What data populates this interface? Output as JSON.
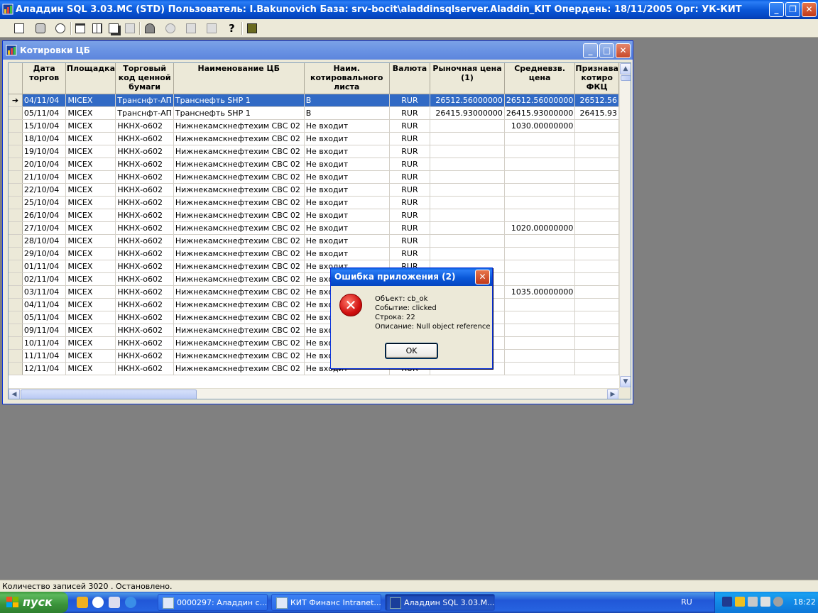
{
  "app": {
    "title": "Аладдин SQL 3.03.MC (STD)  Пользователь: I.Bakunovich База: srv-bocit\\aladdinsqlserver.Aladdin_KIT Опердень: 18/11/2005 Орг: УК-КИТ"
  },
  "window": {
    "title": "Котировки ЦБ"
  },
  "grid": {
    "columns": [
      "Дата торгов",
      "Площадка",
      "Торговый код ценной бумаги",
      "Наименование ЦБ",
      "Наим. котировального листа",
      "Валюта",
      "Рыночная цена (1)",
      "Средневзв. цена",
      "Признава котиро ФКЦ"
    ],
    "rows": [
      {
        "date": "04/11/04",
        "venue": "MICEX",
        "code": "Транснфт-АП",
        "name": "Транснефть SHP  1",
        "list": "В",
        "cur": "RUR",
        "mkt": "26512.56000000",
        "avg": "26512.56000000",
        "rec": "26512.56",
        "selected": true
      },
      {
        "date": "05/11/04",
        "venue": "MICEX",
        "code": "Транснфт-АП",
        "name": "Транснефть SHP  1",
        "list": "В",
        "cur": "RUR",
        "mkt": "26415.93000000",
        "avg": "26415.93000000",
        "rec": "26415.93"
      },
      {
        "date": "15/10/04",
        "venue": "MICEX",
        "code": "НКНХ-о602",
        "name": "Нижнекамскнефтехим СВС  02",
        "list": "Не входит",
        "cur": "RUR",
        "mkt": "",
        "avg": "1030.00000000",
        "rec": ""
      },
      {
        "date": "18/10/04",
        "venue": "MICEX",
        "code": "НКНХ-о602",
        "name": "Нижнекамскнефтехим СВС  02",
        "list": "Не входит",
        "cur": "RUR",
        "mkt": "",
        "avg": "",
        "rec": ""
      },
      {
        "date": "19/10/04",
        "venue": "MICEX",
        "code": "НКНХ-о602",
        "name": "Нижнекамскнефтехим СВС  02",
        "list": "Не входит",
        "cur": "RUR",
        "mkt": "",
        "avg": "",
        "rec": ""
      },
      {
        "date": "20/10/04",
        "venue": "MICEX",
        "code": "НКНХ-о602",
        "name": "Нижнекамскнефтехим СВС  02",
        "list": "Не входит",
        "cur": "RUR",
        "mkt": "",
        "avg": "",
        "rec": ""
      },
      {
        "date": "21/10/04",
        "venue": "MICEX",
        "code": "НКНХ-о602",
        "name": "Нижнекамскнефтехим СВС  02",
        "list": "Не входит",
        "cur": "RUR",
        "mkt": "",
        "avg": "",
        "rec": ""
      },
      {
        "date": "22/10/04",
        "venue": "MICEX",
        "code": "НКНХ-о602",
        "name": "Нижнекамскнефтехим СВС  02",
        "list": "Не входит",
        "cur": "RUR",
        "mkt": "",
        "avg": "",
        "rec": ""
      },
      {
        "date": "25/10/04",
        "venue": "MICEX",
        "code": "НКНХ-о602",
        "name": "Нижнекамскнефтехим СВС  02",
        "list": "Не входит",
        "cur": "RUR",
        "mkt": "",
        "avg": "",
        "rec": ""
      },
      {
        "date": "26/10/04",
        "venue": "MICEX",
        "code": "НКНХ-о602",
        "name": "Нижнекамскнефтехим СВС  02",
        "list": "Не входит",
        "cur": "RUR",
        "mkt": "",
        "avg": "",
        "rec": ""
      },
      {
        "date": "27/10/04",
        "venue": "MICEX",
        "code": "НКНХ-о602",
        "name": "Нижнекамскнефтехим СВС  02",
        "list": "Не входит",
        "cur": "RUR",
        "mkt": "",
        "avg": "1020.00000000",
        "rec": ""
      },
      {
        "date": "28/10/04",
        "venue": "MICEX",
        "code": "НКНХ-о602",
        "name": "Нижнекамскнефтехим СВС  02",
        "list": "Не входит",
        "cur": "RUR",
        "mkt": "",
        "avg": "",
        "rec": ""
      },
      {
        "date": "29/10/04",
        "venue": "MICEX",
        "code": "НКНХ-о602",
        "name": "Нижнекамскнефтехим СВС  02",
        "list": "Не входит",
        "cur": "RUR",
        "mkt": "",
        "avg": "",
        "rec": ""
      },
      {
        "date": "01/11/04",
        "venue": "MICEX",
        "code": "НКНХ-о602",
        "name": "Нижнекамскнефтехим СВС  02",
        "list": "Не входит",
        "cur": "RUR",
        "mkt": "",
        "avg": "",
        "rec": ""
      },
      {
        "date": "02/11/04",
        "venue": "MICEX",
        "code": "НКНХ-о602",
        "name": "Нижнекамскнефтехим СВС  02",
        "list": "Не входит",
        "cur": "RUR",
        "mkt": "",
        "avg": "",
        "rec": ""
      },
      {
        "date": "03/11/04",
        "venue": "MICEX",
        "code": "НКНХ-о602",
        "name": "Нижнекамскнефтехим СВС  02",
        "list": "Не входит",
        "cur": "RUR",
        "mkt": "",
        "avg": "1035.00000000",
        "rec": ""
      },
      {
        "date": "04/11/04",
        "venue": "MICEX",
        "code": "НКНХ-о602",
        "name": "Нижнекамскнефтехим СВС  02",
        "list": "Не входит",
        "cur": "RUR",
        "mkt": "",
        "avg": "",
        "rec": ""
      },
      {
        "date": "05/11/04",
        "venue": "MICEX",
        "code": "НКНХ-о602",
        "name": "Нижнекамскнефтехим СВС  02",
        "list": "Не входит",
        "cur": "RUR",
        "mkt": "",
        "avg": "",
        "rec": ""
      },
      {
        "date": "09/11/04",
        "venue": "MICEX",
        "code": "НКНХ-о602",
        "name": "Нижнекамскнефтехим СВС  02",
        "list": "Не входит",
        "cur": "RUR",
        "mkt": "",
        "avg": "",
        "rec": ""
      },
      {
        "date": "10/11/04",
        "venue": "MICEX",
        "code": "НКНХ-о602",
        "name": "Нижнекамскнефтехим СВС  02",
        "list": "Не входит",
        "cur": "RUR",
        "mkt": "",
        "avg": "",
        "rec": ""
      },
      {
        "date": "11/11/04",
        "venue": "MICEX",
        "code": "НКНХ-о602",
        "name": "Нижнекамскнефтехим СВС  02",
        "list": "Не входит",
        "cur": "RUR",
        "mkt": "",
        "avg": "",
        "rec": ""
      },
      {
        "date": "12/11/04",
        "venue": "MICEX",
        "code": "НКНХ-о602",
        "name": "Нижнекамскнефтехим СВС  02",
        "list": "Не входит",
        "cur": "RUR",
        "mkt": "",
        "avg": "",
        "rec": ""
      }
    ]
  },
  "dialog": {
    "title": "Ошибка приложения (2)",
    "line1": "Объект: cb_ok",
    "line2": "Событие: clicked",
    "line3": "Строка: 22",
    "line4": "Описание: Null object reference",
    "ok_label": "OK"
  },
  "status": {
    "text": "Количество записей 3020 . Остановлено."
  },
  "taskbar": {
    "start_label": "пуск",
    "tasks": [
      {
        "label": "0000297: Аладдин с..."
      },
      {
        "label": "КИТ Финанс Intranet..."
      },
      {
        "label": "Аладдин SQL 3.03.M..."
      }
    ],
    "language": "RU",
    "clock": "18:22"
  },
  "colors": {
    "selection": "#316ac5",
    "xp_blue": "#0a58d8",
    "start_green": "#3a933a"
  }
}
